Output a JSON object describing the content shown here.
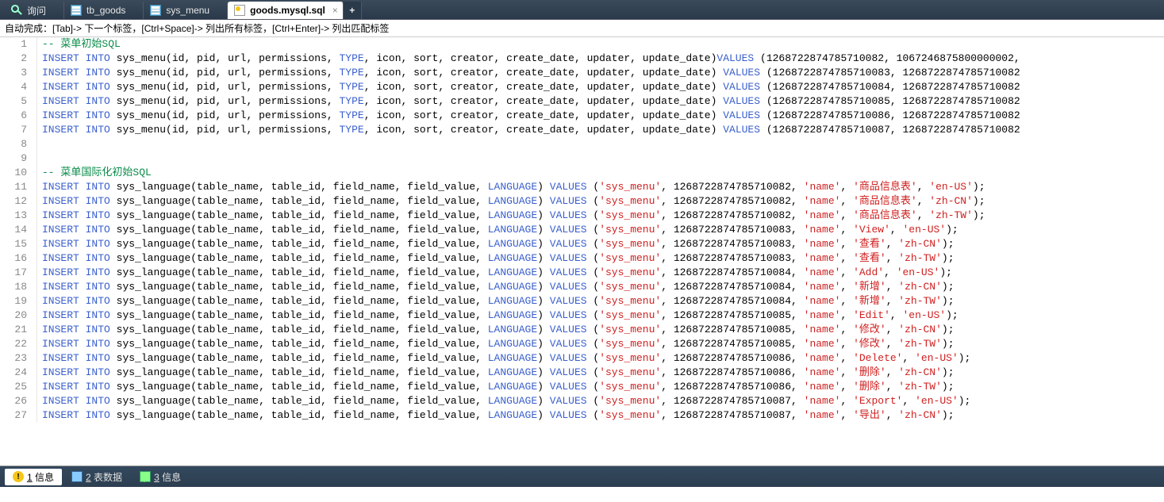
{
  "tabs": [
    {
      "label": "询问",
      "icon": "search-icon"
    },
    {
      "label": "tb_goods",
      "icon": "table-icon"
    },
    {
      "label": "sys_menu",
      "icon": "table-icon"
    },
    {
      "label": "goods.mysql.sql",
      "icon": "sql-icon",
      "active": true
    }
  ],
  "hint": "自动完成：[Tab]-> 下一个标签，[Ctrl+Space]-> 列出所有标签，[Ctrl+Enter]-> 列出匹配标签",
  "sql": {
    "comment_menu": "-- 菜单初始SQL",
    "insert": "INSERT",
    "into": "INTO",
    "values": "VALUES",
    "type": "TYPE",
    "language": "LANGUAGE",
    "menu_sig": " sys_menu(id, pid, url, permissions, ",
    "menu_sig2": ", icon, sort, creator, create_date, updater, update_date)",
    "menu_rows": [
      {
        "sep": "",
        "id": "1268722874785710082",
        "v2": "1067246875800000002,"
      },
      {
        "sep": " ",
        "id": "1268722874785710083",
        "v2": "1268722874785710082"
      },
      {
        "sep": " ",
        "id": "1268722874785710084",
        "v2": "1268722874785710082"
      },
      {
        "sep": " ",
        "id": "1268722874785710085",
        "v2": "1268722874785710082"
      },
      {
        "sep": " ",
        "id": "1268722874785710086",
        "v2": "1268722874785710082"
      },
      {
        "sep": " ",
        "id": "1268722874785710087",
        "v2": "1268722874785710082"
      }
    ],
    "comment_lang": "-- 菜单国际化初始SQL",
    "lang_sig": " sys_language(table_name, table_id, field_name, field_value, ",
    "lang_rows": [
      {
        "id": "1268722874785710082",
        "val": "商品信息表",
        "lang": "en-US"
      },
      {
        "id": "1268722874785710082",
        "val": "商品信息表",
        "lang": "zh-CN"
      },
      {
        "id": "1268722874785710082",
        "val": "商品信息表",
        "lang": "zh-TW"
      },
      {
        "id": "1268722874785710083",
        "val": "View",
        "lang": "en-US"
      },
      {
        "id": "1268722874785710083",
        "val": "查看",
        "lang": "zh-CN"
      },
      {
        "id": "1268722874785710083",
        "val": "查看",
        "lang": "zh-TW"
      },
      {
        "id": "1268722874785710084",
        "val": "Add",
        "lang": "en-US"
      },
      {
        "id": "1268722874785710084",
        "val": "新增",
        "lang": "zh-CN"
      },
      {
        "id": "1268722874785710084",
        "val": "新增",
        "lang": "zh-TW"
      },
      {
        "id": "1268722874785710085",
        "val": "Edit",
        "lang": "en-US"
      },
      {
        "id": "1268722874785710085",
        "val": "修改",
        "lang": "zh-CN"
      },
      {
        "id": "1268722874785710085",
        "val": "修改",
        "lang": "zh-TW"
      },
      {
        "id": "1268722874785710086",
        "val": "Delete",
        "lang": "en-US"
      },
      {
        "id": "1268722874785710086",
        "val": "删除",
        "lang": "zh-CN"
      },
      {
        "id": "1268722874785710086",
        "val": "删除",
        "lang": "zh-TW"
      },
      {
        "id": "1268722874785710087",
        "val": "Export",
        "lang": "en-US"
      },
      {
        "id": "1268722874785710087",
        "val": "导出",
        "lang": "zh-CN"
      }
    ]
  },
  "status": [
    {
      "num": "1",
      "label": "信息",
      "icon": "info-icon",
      "active": true
    },
    {
      "num": "2",
      "label": "表数据",
      "icon": "data-icon"
    },
    {
      "num": "3",
      "label": "信息",
      "icon": "msg-icon"
    }
  ]
}
